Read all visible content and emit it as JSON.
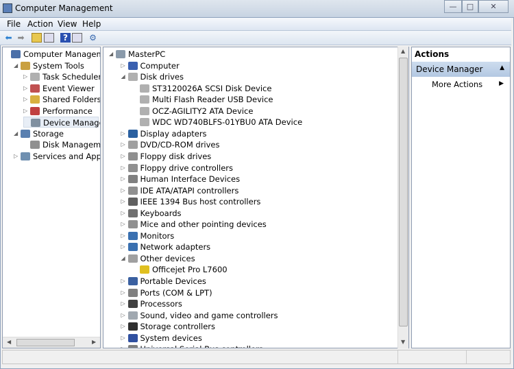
{
  "window": {
    "title": "Computer Management",
    "minimize": "—",
    "maximize": "□",
    "close": "✕"
  },
  "menu": [
    "File",
    "Action",
    "View",
    "Help"
  ],
  "toolbar_icons": [
    "back-arrow-icon",
    "forward-arrow-icon",
    "up-folder-icon",
    "show-hide-tree-icon",
    "help-icon",
    "show-hide-action-pane-icon",
    "properties-icon"
  ],
  "left_tree": [
    {
      "label": "Computer Management",
      "level": 0,
      "arrow": "",
      "icon": "computer-management-icon",
      "color": "#4a6fa8"
    },
    {
      "label": "System Tools",
      "level": 1,
      "arrow": "open",
      "icon": "tools-icon",
      "color": "#c9a040"
    },
    {
      "label": "Task Scheduler",
      "level": 2,
      "arrow": "closed",
      "icon": "clock-icon",
      "color": "#b0b0b0"
    },
    {
      "label": "Event Viewer",
      "level": 2,
      "arrow": "closed",
      "icon": "event-viewer-icon",
      "color": "#c05050"
    },
    {
      "label": "Shared Folders",
      "level": 2,
      "arrow": "closed",
      "icon": "shared-folder-icon",
      "color": "#d8b040"
    },
    {
      "label": "Performance",
      "level": 2,
      "arrow": "closed",
      "icon": "performance-icon",
      "color": "#c04040"
    },
    {
      "label": "Device Manager",
      "level": 2,
      "arrow": "",
      "icon": "device-manager-icon",
      "color": "#8090a0",
      "selected": true
    },
    {
      "label": "Storage",
      "level": 1,
      "arrow": "open",
      "icon": "storage-icon",
      "color": "#5a80b0"
    },
    {
      "label": "Disk Management",
      "level": 2,
      "arrow": "",
      "icon": "disk-management-icon",
      "color": "#909090"
    },
    {
      "label": "Services and Applications",
      "level": 1,
      "arrow": "closed",
      "icon": "services-icon",
      "color": "#7090b0"
    }
  ],
  "device_tree": [
    {
      "label": "MasterPC",
      "level": 0,
      "arrow": "open",
      "icon": "computer-icon",
      "color": "#8a9aaa"
    },
    {
      "label": "Computer",
      "level": 1,
      "arrow": "closed",
      "icon": "computer-icon",
      "color": "#3a60b0"
    },
    {
      "label": "Disk drives",
      "level": 1,
      "arrow": "open",
      "icon": "disk-drive-icon",
      "color": "#b0b0b0"
    },
    {
      "label": "ST3120026A SCSI Disk Device",
      "level": 2,
      "arrow": "",
      "icon": "disk-drive-icon",
      "color": "#b0b0b0"
    },
    {
      "label": "Multi Flash Reader USB Device",
      "level": 2,
      "arrow": "",
      "icon": "disk-drive-icon",
      "color": "#b0b0b0"
    },
    {
      "label": "OCZ-AGILITY2 ATA Device",
      "level": 2,
      "arrow": "",
      "icon": "disk-drive-icon",
      "color": "#b0b0b0"
    },
    {
      "label": "WDC WD740BLFS-01YBU0 ATA Device",
      "level": 2,
      "arrow": "",
      "icon": "disk-drive-icon",
      "color": "#b0b0b0"
    },
    {
      "label": "Display adapters",
      "level": 1,
      "arrow": "closed",
      "icon": "display-adapter-icon",
      "color": "#2a60a0"
    },
    {
      "label": "DVD/CD-ROM drives",
      "level": 1,
      "arrow": "closed",
      "icon": "dvd-drive-icon",
      "color": "#a0a0a0"
    },
    {
      "label": "Floppy disk drives",
      "level": 1,
      "arrow": "closed",
      "icon": "floppy-drive-icon",
      "color": "#909090"
    },
    {
      "label": "Floppy drive controllers",
      "level": 1,
      "arrow": "closed",
      "icon": "floppy-controller-icon",
      "color": "#909090"
    },
    {
      "label": "Human Interface Devices",
      "level": 1,
      "arrow": "closed",
      "icon": "hid-icon",
      "color": "#808080"
    },
    {
      "label": "IDE ATA/ATAPI controllers",
      "level": 1,
      "arrow": "closed",
      "icon": "ide-controller-icon",
      "color": "#909090"
    },
    {
      "label": "IEEE 1394 Bus host controllers",
      "level": 1,
      "arrow": "closed",
      "icon": "ieee1394-icon",
      "color": "#606060"
    },
    {
      "label": "Keyboards",
      "level": 1,
      "arrow": "closed",
      "icon": "keyboard-icon",
      "color": "#707070"
    },
    {
      "label": "Mice and other pointing devices",
      "level": 1,
      "arrow": "closed",
      "icon": "mouse-icon",
      "color": "#909090"
    },
    {
      "label": "Monitors",
      "level": 1,
      "arrow": "closed",
      "icon": "monitor-icon",
      "color": "#3a70b0"
    },
    {
      "label": "Network adapters",
      "level": 1,
      "arrow": "closed",
      "icon": "network-adapter-icon",
      "color": "#3a70b0"
    },
    {
      "label": "Other devices",
      "level": 1,
      "arrow": "open",
      "icon": "unknown-device-icon",
      "color": "#a0a0a0"
    },
    {
      "label": "Officejet Pro L7600",
      "level": 2,
      "arrow": "",
      "icon": "warning-device-icon",
      "color": "#e0c020"
    },
    {
      "label": "Portable Devices",
      "level": 1,
      "arrow": "closed",
      "icon": "portable-device-icon",
      "color": "#3a60a0"
    },
    {
      "label": "Ports (COM & LPT)",
      "level": 1,
      "arrow": "closed",
      "icon": "port-icon",
      "color": "#808080"
    },
    {
      "label": "Processors",
      "level": 1,
      "arrow": "closed",
      "icon": "processor-icon",
      "color": "#404040"
    },
    {
      "label": "Sound, video and game controllers",
      "level": 1,
      "arrow": "closed",
      "icon": "sound-icon",
      "color": "#a0a8b0"
    },
    {
      "label": "Storage controllers",
      "level": 1,
      "arrow": "closed",
      "icon": "storage-controller-icon",
      "color": "#303030"
    },
    {
      "label": "System devices",
      "level": 1,
      "arrow": "closed",
      "icon": "system-device-icon",
      "color": "#3050a0"
    },
    {
      "label": "Universal Serial Bus controllers",
      "level": 1,
      "arrow": "closed",
      "icon": "usb-icon",
      "color": "#808080"
    }
  ],
  "actions": {
    "header": "Actions",
    "section": "Device Manager",
    "item": "More Actions"
  },
  "colors": {
    "section_header": "#b9cde5",
    "selection": "#e8eef6"
  }
}
